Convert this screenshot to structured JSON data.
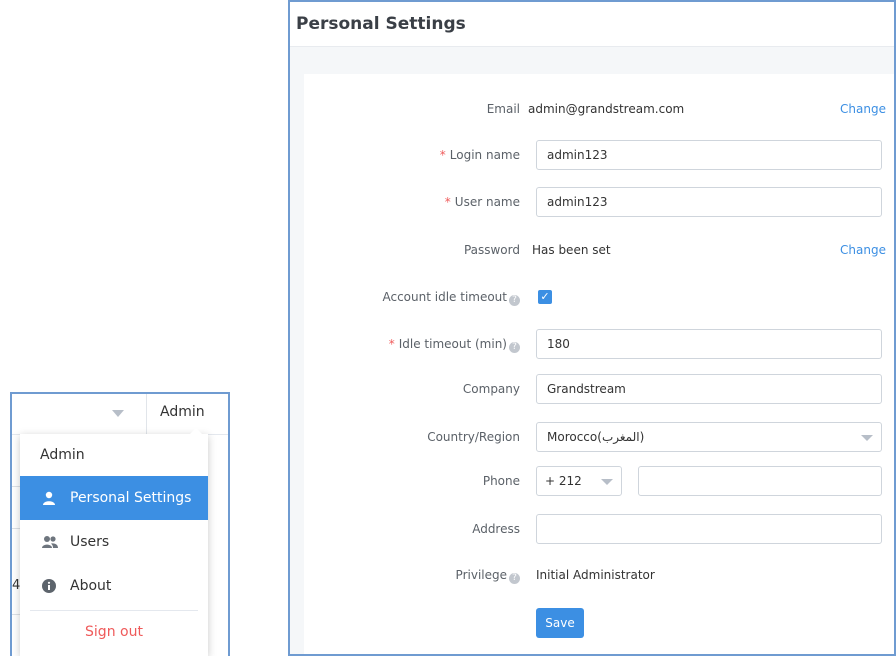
{
  "menu": {
    "topbar_user": "Admin",
    "background_fragment": "4",
    "header": "Admin",
    "items": [
      {
        "label": "Personal Settings",
        "icon": "user-icon",
        "active": true
      },
      {
        "label": "Users",
        "icon": "users-icon",
        "active": false
      },
      {
        "label": "About",
        "icon": "info-icon",
        "active": false
      }
    ],
    "signout": "Sign out"
  },
  "settings": {
    "title": "Personal Settings",
    "email": {
      "label": "Email",
      "value": "admin@grandstream.com",
      "action": "Change"
    },
    "login_name": {
      "label": "Login name",
      "value": "admin123",
      "required": true
    },
    "user_name": {
      "label": "User name",
      "value": "admin123",
      "required": true
    },
    "password": {
      "label": "Password",
      "value": "Has been set",
      "action": "Change"
    },
    "account_idle_timeout": {
      "label": "Account idle timeout",
      "checked": true
    },
    "idle_timeout": {
      "label": "Idle timeout (min)",
      "value": "180",
      "required": true
    },
    "company": {
      "label": "Company",
      "value": "Grandstream"
    },
    "country": {
      "label": "Country/Region",
      "value": "Morocco(المغرب)"
    },
    "phone": {
      "label": "Phone",
      "code": "+ 212",
      "value": ""
    },
    "address": {
      "label": "Address",
      "value": ""
    },
    "privilege": {
      "label": "Privilege",
      "value": "Initial Administrator"
    },
    "save_label": "Save"
  },
  "colors": {
    "accent": "#3c8fe3",
    "danger": "#ef5a5a",
    "frame": "#6f9bd1"
  }
}
